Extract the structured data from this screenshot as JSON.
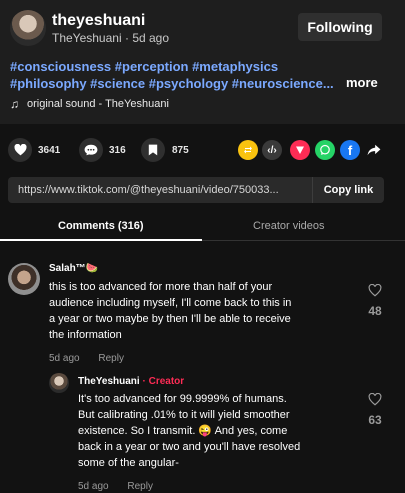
{
  "author": {
    "username": "theyeshuani",
    "display_name": "TheYeshuani",
    "posted": "5d ago",
    "follow_label": "Following"
  },
  "caption": {
    "hashtags_line1": "#consciousness #perception #metaphysics",
    "hashtags_line2": "#philosophy #science #psychology #neuroscience...",
    "more_label": "more"
  },
  "sound": {
    "label": "original sound - TheYeshuani",
    "icon": "music-note-icon"
  },
  "stats": {
    "likes": "3641",
    "comments": "316",
    "saves": "875"
  },
  "share_icons": [
    "repost-icon",
    "embed-icon",
    "send-icon",
    "whatsapp-icon",
    "facebook-icon",
    "share-arrow-icon"
  ],
  "colors": {
    "accent": "#fe2c55",
    "hashtag": "#7ba9ff",
    "repost": "#f9c20f",
    "send": "#fe2c55",
    "whatsapp": "#25d366",
    "facebook": "#1877f2"
  },
  "link": {
    "url": "https://www.tiktok.com/@theyeshuani/video/750033...",
    "copy_label": "Copy link"
  },
  "tabs": {
    "comments": "Comments (316)",
    "creator": "Creator videos"
  },
  "comments": [
    {
      "author": "Salah™🍉",
      "lines": [
        "this is too advanced for more than half of your",
        "audience including myself, I'll come back to this in",
        "a year or two maybe by then I'll be able to receive",
        "the information"
      ],
      "time": "5d ago",
      "reply_label": "Reply",
      "likes": "48"
    }
  ],
  "reply": {
    "author": "TheYeshuani",
    "separator": "·",
    "badge": "Creator",
    "lines": [
      "It's too advanced for 99.9999% of humans.",
      "But calibrating .01% to it will yield smoother",
      "existence. So I transmit. 😜 And yes, come",
      "back in a year or two and you'll have resolved",
      "some of the angular-"
    ],
    "time": "5d ago",
    "reply_label": "Reply",
    "likes": "63"
  }
}
